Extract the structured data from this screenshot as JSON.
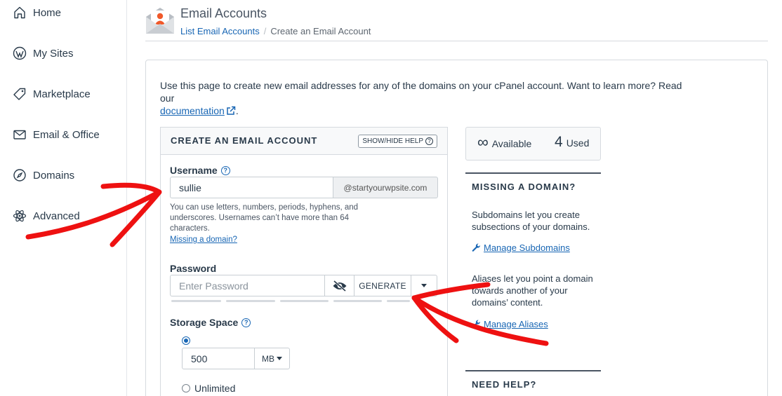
{
  "sidebar": {
    "items": [
      {
        "label": "Home",
        "icon": "home-icon"
      },
      {
        "label": "My Sites",
        "icon": "wordpress-icon"
      },
      {
        "label": "Marketplace",
        "icon": "tag-icon"
      },
      {
        "label": "Email & Office",
        "icon": "envelope-icon"
      },
      {
        "label": "Domains",
        "icon": "compass-icon"
      },
      {
        "label": "Advanced",
        "icon": "atom-icon"
      }
    ]
  },
  "header": {
    "title": "Email Accounts",
    "breadcrumb": {
      "parent": "List Email Accounts",
      "separator": "/",
      "current": "Create an Email Account"
    }
  },
  "intro": {
    "text": "Use this page to create new email addresses for any of the domains on your cPanel account. Want to learn more? Read our ",
    "link": "documentation",
    "end": "."
  },
  "form": {
    "title": "CREATE AN EMAIL ACCOUNT",
    "help_button": "SHOW/HIDE HELP",
    "username_label": "Username",
    "username_value": "sullie",
    "domain_suffix": "@startyourwpsite.com",
    "username_hint": "You can use letters, numbers, periods, hyphens, and underscores. Usernames can’t have more than 64 characters.",
    "missing_domain_link": "Missing a domain?",
    "password_label": "Password",
    "password_placeholder": "Enter Password",
    "generate_button": "GENERATE",
    "storage_label": "Storage Space",
    "storage_value": "500",
    "storage_unit": "MB",
    "unlimited_label": "Unlimited"
  },
  "stats": {
    "available_symbol": "∞",
    "available_label": "Available",
    "used_count": "4",
    "used_label": "Used"
  },
  "side": {
    "missing_heading": "MISSING A DOMAIN?",
    "subdomains_text": "Subdomains let you create subsections of your domains.",
    "subdomains_link": "Manage Subdomains",
    "aliases_text": "Aliases let you point a domain towards another of your domains’ content.",
    "aliases_link": "Manage Aliases",
    "need_help_heading": "NEED HELP?"
  },
  "colors": {
    "link": "#1866b4",
    "text": "#293a4a",
    "annotation": "#ee1111"
  }
}
